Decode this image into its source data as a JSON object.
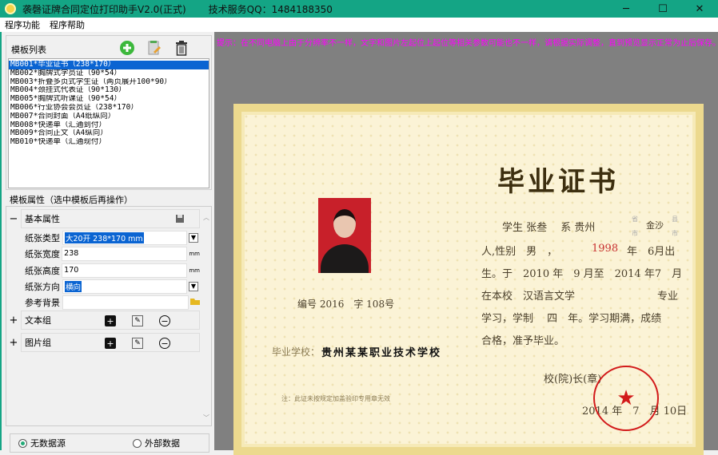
{
  "window": {
    "title": "袭磬证牌合同定位打印助手V2.0(正式)",
    "support": "技术服务QQ：1484188350",
    "min": "─",
    "max": "☐",
    "close": "✕"
  },
  "menu": [
    "程序功能",
    "程序帮助"
  ],
  "template_list": {
    "label": "模板列表",
    "items": [
      "MB001*毕业证书（238*170）",
      "MB002*胸牌式学员证（90*54）",
      "MB003*折叠多页式学生证（两页展开100*90）",
      "MB004*颈挂式代表证（90*130）",
      "MB005*胸牌式听课证（90*54）",
      "MB006*行业协会会员证（238*170）",
      "MB007*合同封面（A4纸纵向）",
      "MB008*快递单（汇通到付）",
      "MB009*合同正文（A4纵向）",
      "MB010*快递单（汇通现付）"
    ],
    "selected": 0
  },
  "properties": {
    "label": "模板属性（选中模板后再操作）",
    "basic": {
      "title": "基本属性",
      "expander": "−",
      "paper_type_label": "纸张类型",
      "paper_type": "大20开 238*170 mm",
      "width_label": "纸张宽度",
      "width": "238",
      "height_label": "纸张高度",
      "height": "170",
      "orientation_label": "纸张方向",
      "orientation": "横向",
      "background_label": "参考背景",
      "background": "",
      "unit": "mm"
    },
    "text_group": {
      "title": "文本组",
      "expander": "+"
    },
    "image_group": {
      "title": "图片组",
      "expander": "+"
    }
  },
  "datasource": {
    "options": [
      "无数据源",
      "外部数据"
    ],
    "selected": 0
  },
  "tip": "提示：在不同电脑上由于分辨率不一样，文字和图片左起位上起位等相关参数可能也不一样，请根据实际调整，直到预览显示正常为止后保存。",
  "certificate": {
    "title": "毕业证书",
    "line1": "学生 张叁　 系 贵州",
    "prov": "省\n市",
    "county": "金沙",
    "xian": "县\n市",
    "line2a": "人,性别　男　，",
    "year": "1998",
    "line2b": "年　6月出",
    "line3": "生。于　2010 年　9 月至　2014 年7　月",
    "line4a": "在本校　汉语言文学",
    "line4b": "专业",
    "line5": "学习，学制　 四　年。学习期满，成绩",
    "line6": "合格，准予毕业。",
    "number": "编号 2016　字 108号",
    "school_label": "毕业学校：",
    "school": "贵州某某职业技术学校",
    "note": "注：此证未按规定加盖验印专用章无效",
    "principal": "校(院)长(章)",
    "date": "2014 年　7　月 10日",
    "stamp_star": "★"
  }
}
